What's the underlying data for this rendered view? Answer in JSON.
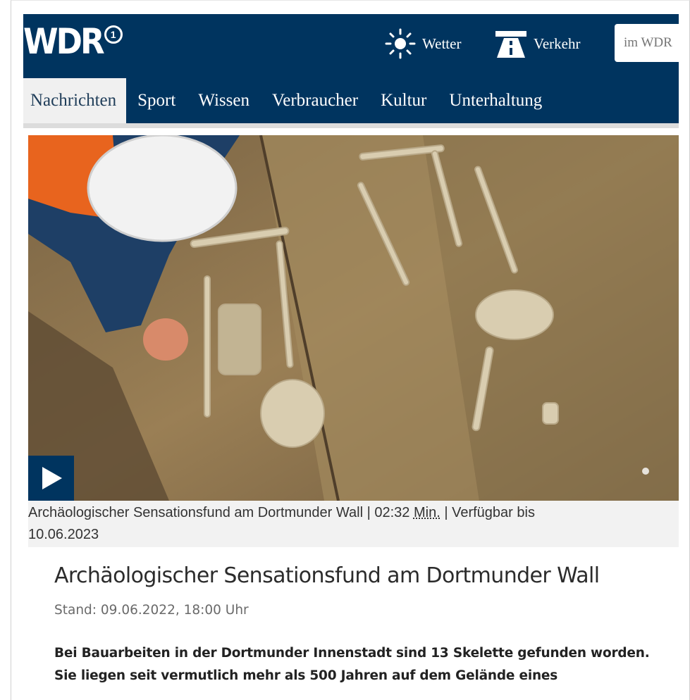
{
  "header": {
    "logo": "WDR",
    "logo_badge": "1",
    "weather_label": "Wetter",
    "traffic_label": "Verkehr",
    "search_placeholder": "im WDR"
  },
  "nav": {
    "items": [
      {
        "label": "Nachrichten",
        "active": true
      },
      {
        "label": "Sport"
      },
      {
        "label": "Wissen"
      },
      {
        "label": "Verbraucher"
      },
      {
        "label": "Kultur"
      },
      {
        "label": "Unterhaltung"
      }
    ]
  },
  "video": {
    "caption_title": "Archäologischer Sensationsfund am Dortmunder Wall",
    "duration": "02:32",
    "duration_unit": "Min.",
    "available_label": "Verfügbar bis",
    "available_date": "10.06.2023"
  },
  "article": {
    "headline": "Archäologischer Sensationsfund am Dortmunder Wall",
    "stand": "Stand: 09.06.2022, 18:00 Uhr",
    "lead": "Bei Bauarbeiten in der Dortmunder Innenstadt sind 13 Skelette gefunden worden. Sie liegen seit vermutlich mehr als 500 Jahren auf dem Gelände eines"
  },
  "colors": {
    "brand": "#00345f",
    "nav_active_bg": "#f0f0f0",
    "caption_bg": "#f2f2f2"
  }
}
